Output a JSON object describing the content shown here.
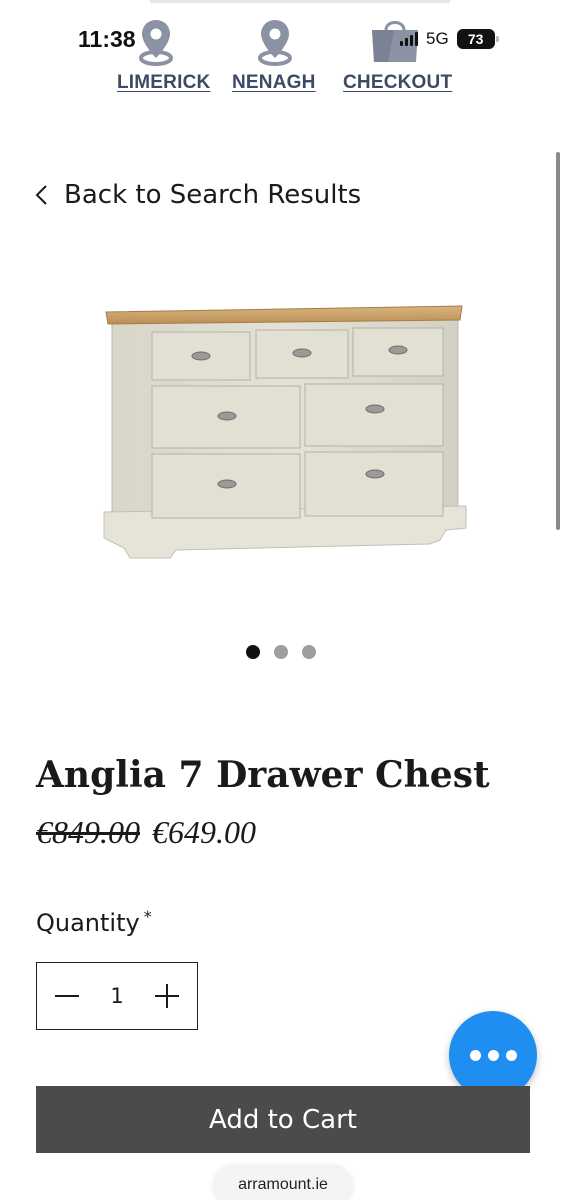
{
  "status_bar": {
    "time": "11:38",
    "network": "5G",
    "battery": "73"
  },
  "top_nav": {
    "links": [
      {
        "label": "LIMERICK",
        "icon": "location-pin-icon"
      },
      {
        "label": "NENAGH",
        "icon": "location-pin-icon"
      },
      {
        "label": "CHECKOUT",
        "icon": "shopping-bag-icon"
      }
    ],
    "link_color": "#3d4a66"
  },
  "back_link": {
    "label": "Back to Search Results",
    "icon": "chevron-left-icon"
  },
  "gallery": {
    "image_alt": "Anglia 7 Drawer Chest",
    "slides": 3,
    "active_slide": 1
  },
  "product": {
    "name": "Anglia 7 Drawer Chest",
    "original_price": "€849.00",
    "sale_price": "€649.00"
  },
  "quantity": {
    "label": "Quantity",
    "required_mark": "*",
    "value": "1",
    "decrement_icon": "minus-icon",
    "increment_icon": "plus-icon"
  },
  "cart": {
    "button_label": "Add to Cart",
    "button_color": "#4b4b4b"
  },
  "chat": {
    "icon": "more-dots-icon",
    "color": "#1e8ef0"
  },
  "browser": {
    "domain": "arramount.ie"
  }
}
